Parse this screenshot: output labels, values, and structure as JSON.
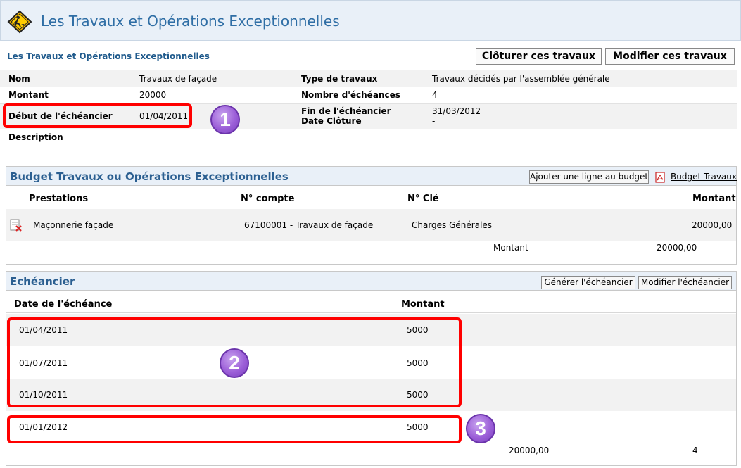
{
  "header": {
    "title": "Les Travaux et Opérations Exceptionnelles",
    "icon": "roadwork-sign-icon"
  },
  "section": {
    "subtitle": "Les Travaux et Opérations Exceptionnelles",
    "close_label": "Clôturer ces travaux",
    "edit_label": "Modifier ces travaux"
  },
  "info": {
    "nom_label": "Nom",
    "nom": "Travaux de façade",
    "type_label": "Type de travaux",
    "type": "Travaux décidés par l'assemblée générale",
    "montant_label": "Montant",
    "montant": "20000",
    "echeances_label": "Nombre d'échéances",
    "echeances": "4",
    "debut_label": "Début de l'échéancier",
    "debut": "01/04/2011",
    "fin_label": "Fin de l'échéancier",
    "fin": "31/03/2012",
    "cloture_label": "Date Clôture",
    "cloture": "-",
    "description_label": "Description"
  },
  "budget": {
    "title": "Budget Travaux ou Opérations Exceptionnelles",
    "add_line_label": "Ajouter une ligne au budget",
    "pdf_link": "Budget Travaux",
    "columns": [
      "Prestations",
      "N° compte",
      "N° Clé",
      "Montant"
    ],
    "rows": [
      {
        "prestation": "Maçonnerie façade",
        "compte": "67100001 - Travaux de façade",
        "cle": "Charges Générales",
        "montant": "20000,00"
      }
    ],
    "total_label": "Montant",
    "total": "20000,00"
  },
  "schedule": {
    "title": "Echéancier",
    "generate_label": "Générer l'échéancier",
    "edit_label": "Modifier l'échéancier",
    "columns": [
      "Date de l'échéance",
      "Montant"
    ],
    "rows": [
      {
        "date": "01/04/2011",
        "montant": "5000"
      },
      {
        "date": "01/07/2011",
        "montant": "5000"
      },
      {
        "date": "01/10/2011",
        "montant": "5000"
      },
      {
        "date": "01/01/2012",
        "montant": "5000"
      }
    ],
    "total": "20000,00",
    "count": "4"
  },
  "annotations": [
    "1",
    "2",
    "3"
  ]
}
